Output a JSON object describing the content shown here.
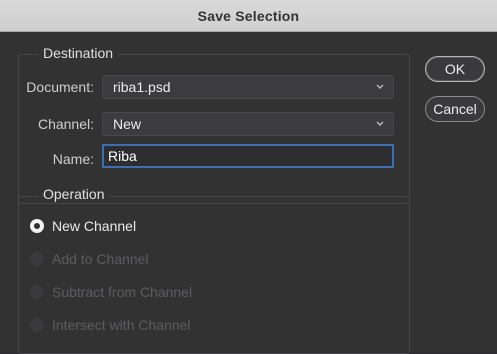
{
  "window": {
    "title": "Save Selection"
  },
  "destination": {
    "group_label": "Destination",
    "document_label": "Document:",
    "document_value": "riba1.psd",
    "channel_label": "Channel:",
    "channel_value": "New",
    "name_label": "Name:",
    "name_value": "Riba"
  },
  "operation": {
    "group_label": "Operation",
    "options": [
      {
        "label": "New Channel",
        "selected": true,
        "enabled": true
      },
      {
        "label": "Add to Channel",
        "selected": false,
        "enabled": false
      },
      {
        "label": "Subtract from Channel",
        "selected": false,
        "enabled": false
      },
      {
        "label": "Intersect with Channel",
        "selected": false,
        "enabled": false
      }
    ]
  },
  "buttons": {
    "ok_label": "OK",
    "cancel_label": "Cancel"
  },
  "icons": {
    "select_chevron": "chevron-down-icon",
    "radio_selected": "radio-selected-icon",
    "radio_unselected": "radio-unselected-icon"
  },
  "colors": {
    "dialog_bg": "#323233",
    "titlebar_bg": "#d6d6d6",
    "focus_border": "#3b6fb0",
    "disabled_text": "#5d5d60"
  }
}
